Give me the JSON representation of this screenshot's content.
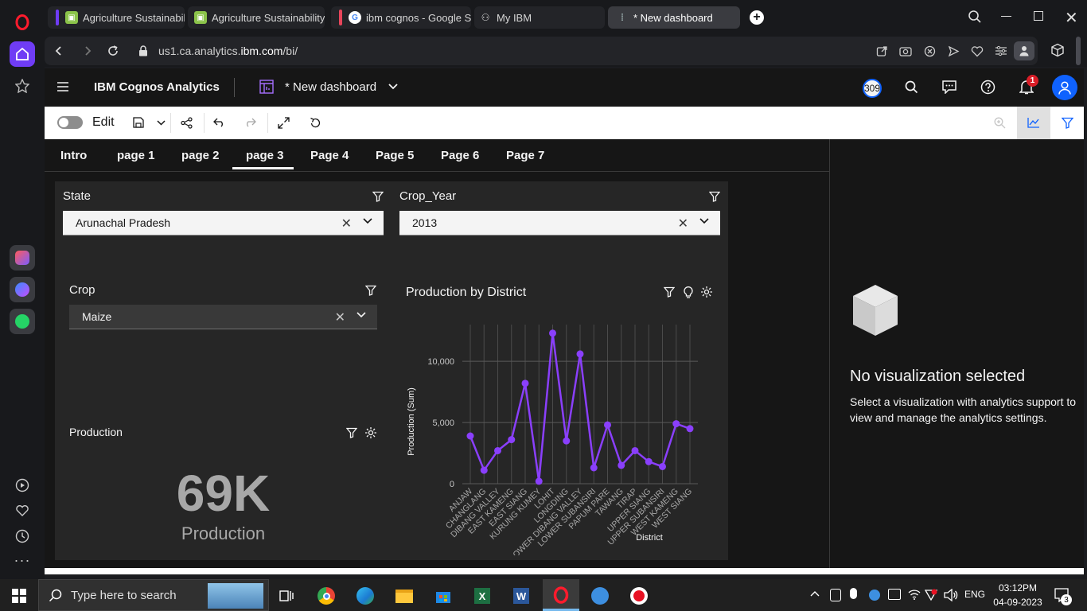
{
  "browser": {
    "tabs": [
      {
        "title": "Agriculture Sustainability",
        "stripe": "#6f3cf5"
      },
      {
        "title": "Agriculture Sustainability",
        "stripe": "#6f3cf5"
      },
      {
        "title": "ibm cognos - Google Sear",
        "stripe": "#e8455a"
      },
      {
        "title": "My IBM",
        "stripe": ""
      },
      {
        "title": "* New dashboard",
        "stripe": ""
      }
    ],
    "url_prefix": "us1.ca.analytics.",
    "url_domain": "ibm.com",
    "url_suffix": "/bi/"
  },
  "app": {
    "product_name": "IBM Cognos Analytics",
    "dashboard_title": "* New dashboard",
    "user_badge": "309",
    "notification_count": "1"
  },
  "toolbar": {
    "edit_label": "Edit"
  },
  "page_tabs": [
    {
      "label": "Intro",
      "active": false
    },
    {
      "label": "page 1",
      "active": false
    },
    {
      "label": "page 2",
      "active": false
    },
    {
      "label": "page 3",
      "active": true
    },
    {
      "label": "Page 4",
      "active": false
    },
    {
      "label": "Page 5",
      "active": false
    },
    {
      "label": "Page 6",
      "active": false
    },
    {
      "label": "Page 7",
      "active": false
    }
  ],
  "filters": {
    "state": {
      "label": "State",
      "value": "Arunachal Pradesh"
    },
    "crop_year": {
      "label": "Crop_Year",
      "value": "2013"
    },
    "crop": {
      "label": "Crop",
      "value": "Maize"
    }
  },
  "kpi": {
    "title": "Production",
    "value": "69K",
    "caption": "Production"
  },
  "chart_widget": {
    "title": "Production by District"
  },
  "chart_data": {
    "type": "line",
    "xlabel": "District",
    "ylabel": "Production (Sum)",
    "ylim": [
      0,
      13000
    ],
    "yticks": [
      "0",
      "5,000",
      "10,000"
    ],
    "ytick_values": [
      0,
      5000,
      10000
    ],
    "grid": true,
    "color": "#8a3ffc",
    "categories": [
      "ANJAW",
      "CHANGLANG",
      "DIBANG VALLEY",
      "EAST KAMENG",
      "EAST SIANG",
      "KURUNG KUMEY",
      "LOHIT",
      "LONGDING",
      "LOWER DIBANG VALLEY",
      "LOWER SUBANSIRI",
      "PAPUM PARE",
      "TAWANG",
      "TIRAP",
      "UPPER SIANG",
      "UPPER SUBANSIRI",
      "WEST KAMENG",
      "WEST SIANG"
    ],
    "point_labels": [
      "ANJAW",
      "CHANGLANG",
      "DIBANG VALLEY",
      "EAST KAMENG",
      "EAST SIANG",
      "KURUNG KUMEY",
      "LOHIT",
      "LONGDING",
      "LOWER DIBANG VALLEY",
      "LOWER SUBANSIRI",
      "PAPUM PARE",
      "TAWANG",
      "TIRAP",
      "UPPER SIANG",
      "UPPER SUBANSIRI",
      "WEST KAMENG",
      "WEST SIANG"
    ],
    "values": [
      3900,
      1100,
      2700,
      3600,
      8200,
      200,
      12300,
      3500,
      10600,
      1300,
      4800,
      1500,
      2700,
      1800,
      1400,
      4900,
      4500
    ]
  },
  "analytics_panel": {
    "heading": "No visualization selected",
    "body": "Select a visualization with analytics support to view and manage the analytics settings."
  },
  "taskbar": {
    "search_placeholder": "Type here to search",
    "language": "ENG",
    "time": "03:12PM",
    "date": "04-09-2023",
    "notification_count": "3"
  }
}
